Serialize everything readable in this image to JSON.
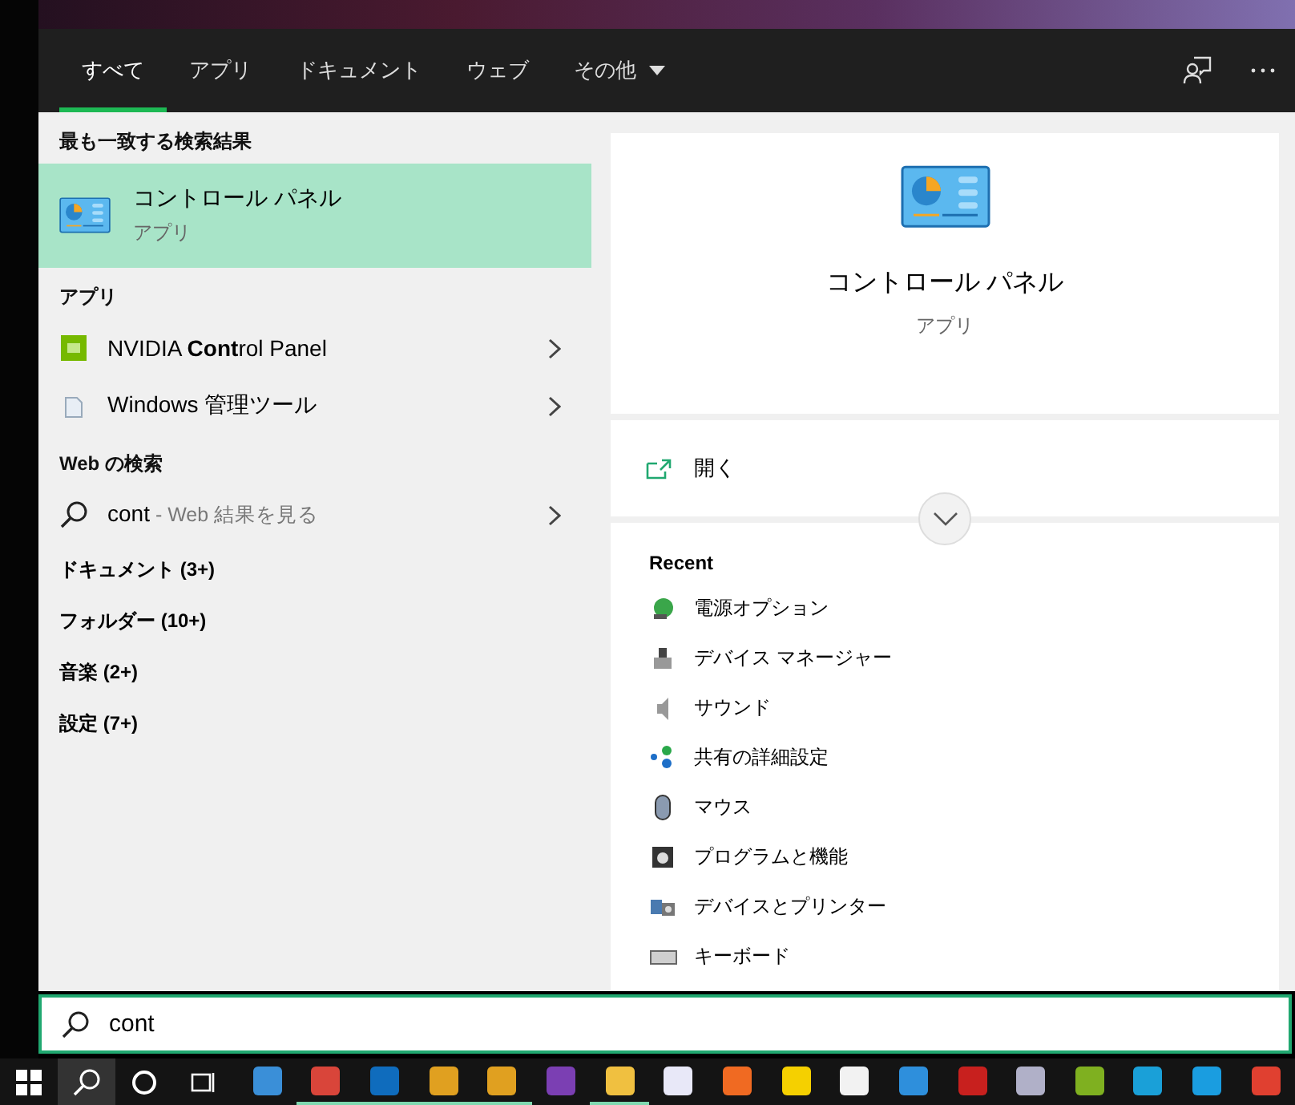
{
  "tabs": [
    {
      "label": "すべて",
      "selected": true,
      "dropdown": false
    },
    {
      "label": "アプリ",
      "selected": false,
      "dropdown": false
    },
    {
      "label": "ドキュメント",
      "selected": false,
      "dropdown": false
    },
    {
      "label": "ウェブ",
      "selected": false,
      "dropdown": false
    },
    {
      "label": "その他",
      "selected": false,
      "dropdown": true
    }
  ],
  "results": [
    {
      "kind": "header",
      "label": "最も一致する検索結果"
    },
    {
      "kind": "best",
      "title": "コントロール パネル",
      "subtitle": "アプリ",
      "selected": true
    },
    {
      "kind": "header",
      "label": "アプリ"
    },
    {
      "kind": "app",
      "label": "NVIDIA **Cont**rol Panel",
      "selected": false
    },
    {
      "kind": "app",
      "label": "Windows 管理ツール",
      "selected": false
    },
    {
      "kind": "header",
      "label": "Web の検索"
    },
    {
      "kind": "web",
      "query": "cont",
      "hint": " - Web 結果を見る",
      "selected": false
    },
    {
      "kind": "category",
      "label": "ドキュメント (3+)"
    },
    {
      "kind": "category",
      "label": "フォルダー (10+)"
    },
    {
      "kind": "category",
      "label": "音楽 (2+)"
    },
    {
      "kind": "category",
      "label": "設定 (7+)"
    }
  ],
  "preview": {
    "title": "コントロール パネル",
    "subtitle": "アプリ",
    "action": "開く",
    "recent_title": "Recent",
    "recent": [
      "電源オプション",
      "デバイス マネージャー",
      "サウンド",
      "共有の詳細設定",
      "マウス",
      "プログラムと機能",
      "デバイスとプリンター",
      "キーボード"
    ]
  },
  "search": {
    "value": "cont"
  },
  "taskbar": {
    "apps": [
      {
        "color": "#3a8fd8",
        "running": false
      },
      {
        "color": "#d9453a",
        "running": true
      },
      {
        "color": "#0f6cbd",
        "running": true
      },
      {
        "color": "#e0a020",
        "running": true
      },
      {
        "color": "#e0a020",
        "running": true
      },
      {
        "color": "#7b3fb3",
        "running": false
      },
      {
        "color": "#f0c040",
        "running": true
      },
      {
        "color": "#e8e8f8",
        "running": false
      },
      {
        "color": "#f06a22",
        "running": false
      },
      {
        "color": "#f5d000",
        "running": false
      },
      {
        "color": "#f2f2f2",
        "running": false
      },
      {
        "color": "#2e8fdc",
        "running": false
      },
      {
        "color": "#c8201e",
        "running": false
      },
      {
        "color": "#b0b0c8",
        "running": false
      },
      {
        "color": "#7fb020",
        "running": false
      },
      {
        "color": "#1aa0d8",
        "running": false
      },
      {
        "color": "#1a9de0",
        "running": false
      },
      {
        "color": "#e04030",
        "running": false
      }
    ]
  }
}
